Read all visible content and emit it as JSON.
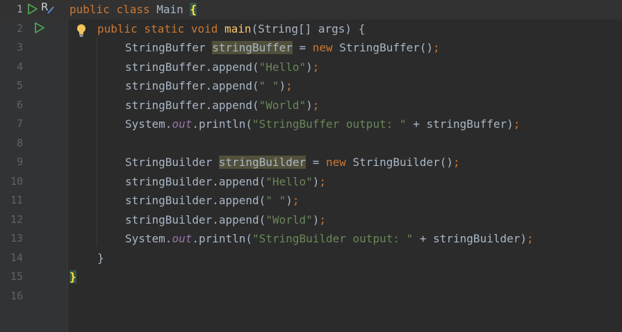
{
  "editor": {
    "line_numbers": [
      "1",
      "2",
      "3",
      "4",
      "5",
      "6",
      "7",
      "8",
      "9",
      "10",
      "11",
      "12",
      "13",
      "14",
      "15",
      "16"
    ],
    "gutter_icons": {
      "line1_run": "run-icon",
      "line1_r": "R",
      "line2_run": "run-icon",
      "intention": "lightbulb-icon"
    },
    "lines": {
      "l1": {
        "kw1": "public ",
        "kw2": "class ",
        "name": "Main ",
        "brace": "{"
      },
      "l2": {
        "kw": "public static void ",
        "fn": "main",
        "rest": "(String[] args) {"
      },
      "l3": {
        "type": "StringBuffer ",
        "var": "stringBuffer",
        "eq": " = ",
        "kw": "new ",
        "ctor": "StringBuffer()",
        "semi": ";"
      },
      "l4": {
        "pre": "stringBuffer.append(",
        "str": "\"Hello\"",
        "post": ")",
        "semi": ";"
      },
      "l5": {
        "pre": "stringBuffer.append(",
        "str": "\" \"",
        "post": ")",
        "semi": ";"
      },
      "l6": {
        "pre": "stringBuffer.append(",
        "str": "\"World\"",
        "post": ")",
        "semi": ";"
      },
      "l7": {
        "pre": "System.",
        "field": "out",
        "mid": ".println(",
        "str": "\"StringBuffer output: \"",
        "post": " + stringBuffer)",
        "semi": ";"
      },
      "l9": {
        "type": "StringBuilder ",
        "var": "stringBuilder",
        "eq": " = ",
        "kw": "new ",
        "ctor": "StringBuilder()",
        "semi": ";"
      },
      "l10": {
        "pre": "stringBuilder.append(",
        "str": "\"Hello\"",
        "post": ")",
        "semi": ";"
      },
      "l11": {
        "pre": "stringBuilder.append(",
        "str": "\" \"",
        "post": ")",
        "semi": ";"
      },
      "l12": {
        "pre": "stringBuilder.append(",
        "str": "\"World\"",
        "post": ")",
        "semi": ";"
      },
      "l13": {
        "pre": "System.",
        "field": "out",
        "mid": ".println(",
        "str": "\"StringBuilder output: \"",
        "post": " + stringBuilder)",
        "semi": ";"
      },
      "l14": {
        "text": "}"
      },
      "l15": {
        "brace": "}"
      }
    }
  },
  "colors": {
    "background": "#2b2b2b",
    "keyword": "#cc7832",
    "function": "#ffc66d",
    "string": "#6a8759",
    "field": "#9876aa",
    "default": "#a9b7c6",
    "run": "#4ea24e"
  }
}
